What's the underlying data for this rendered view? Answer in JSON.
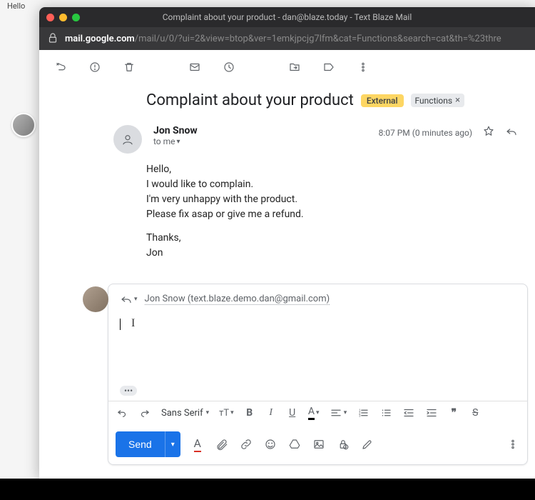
{
  "desktop_hint": "Hello",
  "window": {
    "title": "Complaint about your product - dan@blaze.today - Text Blaze Mail"
  },
  "url": {
    "scheme_host": "mail.google.com",
    "path": "/mail/u/0/?ui=2&view=btop&ver=1emkjpcjg7lfm&cat=Functions&search=cat&th=%23thre"
  },
  "subject": {
    "text": "Complaint about your product",
    "external_badge": "External",
    "category_badge": "Functions"
  },
  "message": {
    "sender_name": "Jon Snow",
    "recipient_line": "to me",
    "timestamp": "8:07 PM (0 minutes ago)",
    "body_lines": [
      "Hello,",
      "I would like to complain.",
      "I'm very unhappy with the product.",
      "Please fix asap or give me a refund."
    ],
    "closing_lines": [
      "Thanks,",
      "Jon"
    ]
  },
  "reply": {
    "to_display": "Jon Snow (text.blaze.demo.dan@gmail.com)",
    "font_family": "Sans Serif",
    "send_label": "Send"
  }
}
